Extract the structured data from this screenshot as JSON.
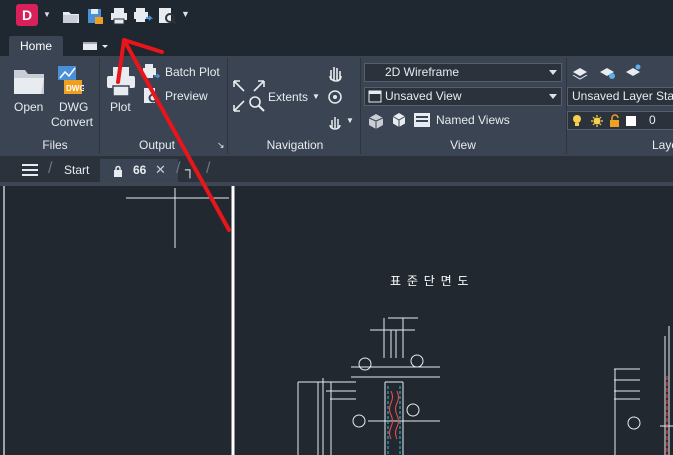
{
  "app": {
    "logo_letter": "D"
  },
  "ribbon_tabs": {
    "home": "Home"
  },
  "files_panel": {
    "title": "Files",
    "open_label": "Open",
    "dwg_convert_label_line1": "DWG",
    "dwg_convert_label_line2": "Convert"
  },
  "output_panel": {
    "title": "Output",
    "plot_label": "Plot",
    "batch_plot_label": "Batch Plot",
    "preview_label": "Preview"
  },
  "navigation_panel": {
    "title": "Navigation",
    "extents_label": "Extents"
  },
  "view_panel": {
    "title": "View",
    "visual_style_value": "2D Wireframe",
    "named_view_value": "Unsaved View",
    "named_views_label": "Named Views"
  },
  "layers_panel": {
    "title_partial": "Laye",
    "layer_state_value": "Unsaved Layer Stat",
    "layer_value": "0"
  },
  "doc_tabs": {
    "start_label": "Start",
    "active_label": "66"
  },
  "drawing": {
    "title_text": "표 준 단 면 도"
  },
  "colors": {
    "accent_logo": "#d8205a",
    "annotation_arrow": "#e8151b",
    "ribbon_bg": "#3a4452",
    "canvas_bg": "#212830"
  }
}
